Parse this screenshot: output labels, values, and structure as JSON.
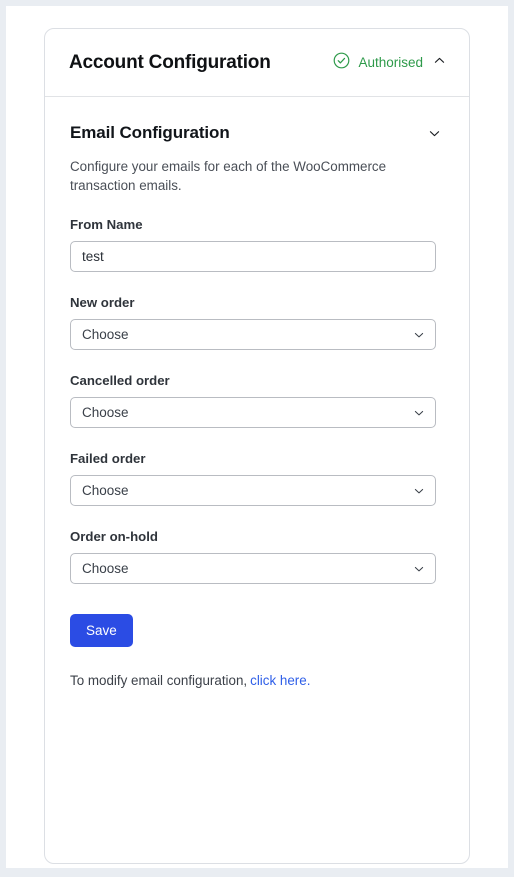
{
  "theme": {
    "page_background": "#e9edf2",
    "card_background": "#ffffff",
    "card_border": "#dcdfe4",
    "accent_blue": "#2b4ce4",
    "link_blue": "#2f5fe8",
    "status_green": "#2e9a4a",
    "input_border": "#b9bcc2"
  },
  "card": {
    "header": {
      "title": "Account Configuration",
      "status_label": "Authorised",
      "status_icon": "check-circle-icon",
      "collapse_icon": "chevron-up-icon"
    },
    "section": {
      "title": "Email Configuration",
      "toggle_icon": "chevron-down-icon",
      "description": "Configure your emails for each of the WooCommerce transaction emails."
    },
    "fields": [
      {
        "name": "from-name",
        "label": "From Name",
        "type": "text",
        "value": "test",
        "placeholder": ""
      },
      {
        "name": "new-order",
        "label": "New order",
        "type": "select",
        "value": "Choose",
        "options": [
          "Choose"
        ]
      },
      {
        "name": "cancelled-order",
        "label": "Cancelled order",
        "type": "select",
        "value": "Choose",
        "options": [
          "Choose"
        ]
      },
      {
        "name": "failed-order",
        "label": "Failed order",
        "type": "select",
        "value": "Choose",
        "options": [
          "Choose"
        ]
      },
      {
        "name": "order-on-hold",
        "label": "Order on-hold",
        "type": "select",
        "value": "Choose",
        "options": [
          "Choose"
        ]
      }
    ],
    "save_button_label": "Save",
    "footer": {
      "text": "To modify email configuration,",
      "link_text": "click here."
    }
  }
}
